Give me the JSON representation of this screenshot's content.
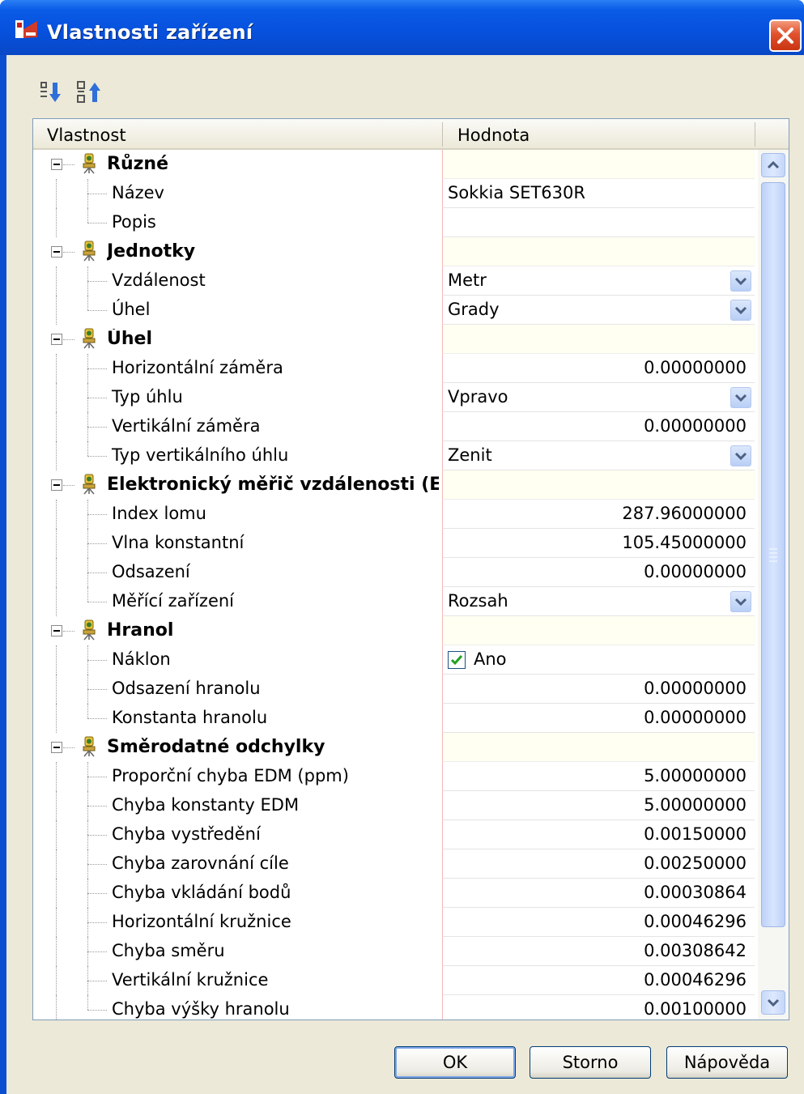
{
  "window": {
    "title": "Vlastnosti zařízení"
  },
  "grid": {
    "headers": {
      "property": "Vlastnost",
      "value": "Hodnota"
    },
    "rows": [
      {
        "kind": "cat",
        "label": "Různé"
      },
      {
        "kind": "text",
        "label": "Název",
        "value": "Sokkia SET630R"
      },
      {
        "kind": "text",
        "label": "Popis",
        "value": ""
      },
      {
        "kind": "cat",
        "label": "Jednotky"
      },
      {
        "kind": "dropdown",
        "label": "Vzdálenost",
        "value": "Metr"
      },
      {
        "kind": "dropdown",
        "label": "Úhel",
        "value": "Grady"
      },
      {
        "kind": "cat",
        "label": "Úhel"
      },
      {
        "kind": "num",
        "label": "Horizontální záměra",
        "value": "0.00000000"
      },
      {
        "kind": "dropdown",
        "label": "Typ úhlu",
        "value": "Vpravo"
      },
      {
        "kind": "num",
        "label": "Vertikální záměra",
        "value": "0.00000000"
      },
      {
        "kind": "dropdown",
        "label": "Typ vertikálního úhlu",
        "value": "Zenit"
      },
      {
        "kind": "cat",
        "label": "Elektronický měřič vzdálenosti (ED..."
      },
      {
        "kind": "num",
        "label": "Index lomu",
        "value": "287.96000000"
      },
      {
        "kind": "num",
        "label": "Vlna konstantní",
        "value": "105.45000000"
      },
      {
        "kind": "num",
        "label": "Odsazení",
        "value": "0.00000000"
      },
      {
        "kind": "dropdown",
        "label": "Měřící zařízení",
        "value": "Rozsah"
      },
      {
        "kind": "cat",
        "label": "Hranol"
      },
      {
        "kind": "check",
        "label": "Náklon",
        "value": "Ano"
      },
      {
        "kind": "num",
        "label": "Odsazení hranolu",
        "value": "0.00000000"
      },
      {
        "kind": "num",
        "label": "Konstanta hranolu",
        "value": "0.00000000"
      },
      {
        "kind": "cat",
        "label": "Směrodatné odchylky"
      },
      {
        "kind": "num",
        "label": "Proporční chyba EDM (ppm)",
        "value": "5.00000000"
      },
      {
        "kind": "num",
        "label": "Chyba konstanty EDM",
        "value": "5.00000000"
      },
      {
        "kind": "num",
        "label": "Chyba vystředění",
        "value": "0.00150000"
      },
      {
        "kind": "num",
        "label": "Chyba zarovnání cíle",
        "value": "0.00250000"
      },
      {
        "kind": "num",
        "label": "Chyba vkládání bodů",
        "value": "0.00030864"
      },
      {
        "kind": "num",
        "label": "Horizontální kružnice",
        "value": "0.00046296"
      },
      {
        "kind": "num",
        "label": "Chyba směru",
        "value": "0.00308642"
      },
      {
        "kind": "num",
        "label": "Vertikální kružnice",
        "value": "0.00046296"
      },
      {
        "kind": "num",
        "label": "Chyba výšky hranolu",
        "value": "0.00100000"
      }
    ]
  },
  "buttons": {
    "ok": "OK",
    "cancel": "Storno",
    "help": "Nápověda"
  },
  "colors": {
    "titlebar": "#0650dc",
    "dialog_bg": "#ece9d8",
    "category_bg": "#fffff2",
    "grid_border": "#7f9db9"
  },
  "icons": {
    "app": "app-device-icon",
    "sort_categorized": "categorized-sort-icon",
    "sort_alpha": "alphabetical-sort-icon",
    "category": "device-category-icon",
    "close": "close-icon"
  }
}
